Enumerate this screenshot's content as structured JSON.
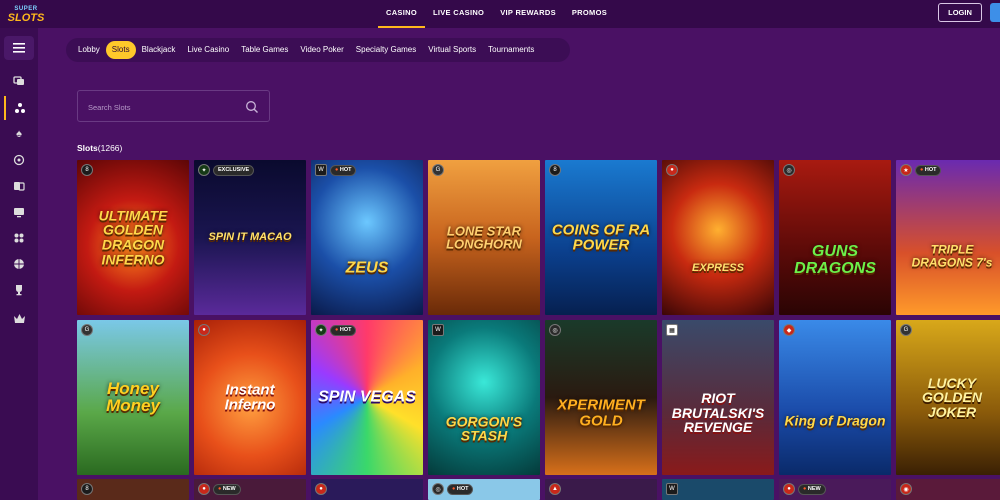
{
  "logo": {
    "line1": "SUPER",
    "line2": "SLOTS"
  },
  "topnav": [
    "CASINO",
    "LIVE CASINO",
    "VIP REWARDS",
    "PROMOS"
  ],
  "topnav_active": "CASINO",
  "login_label": "LOGIN",
  "categories": [
    "Lobby",
    "Slots",
    "Blackjack",
    "Live Casino",
    "Table Games",
    "Video Poker",
    "Specialty Games",
    "Virtual Sports",
    "Tournaments"
  ],
  "active_category": "Slots",
  "search": {
    "placeholder": "Search Slots"
  },
  "section": {
    "title": "Slots",
    "count": "(1266)"
  },
  "sidebar_icons": [
    "menu-icon",
    "chat-icon",
    "slots-icon",
    "spade-icon",
    "roulette-icon",
    "cards-icon",
    "monitor-icon",
    "grid-icon",
    "basketball-icon",
    "trophy-icon",
    "crown-icon"
  ],
  "colors": {
    "accent": "#ffc82a",
    "background": "#4a1164",
    "topbar": "#34094a",
    "sidebar": "#3a0c52"
  },
  "games_row1": [
    {
      "name": "ULTIMATE GOLDEN DRAGON INFERNO",
      "badge": ""
    },
    {
      "name": "SPIN IT MACAO",
      "badge": "EXCLUSIVE"
    },
    {
      "name": "ZEUS",
      "badge": "HOT"
    },
    {
      "name": "LONE STAR LONGHORN",
      "badge": ""
    },
    {
      "name": "COINS OF RA POWER",
      "badge": ""
    },
    {
      "name": "EXPRESS",
      "badge": ""
    },
    {
      "name": "GUNS DRAGONS",
      "badge": ""
    },
    {
      "name": "TRIPLE DRAGONS 7's",
      "badge": "HOT"
    }
  ],
  "games_row2": [
    {
      "name": "Honey Money",
      "badge": ""
    },
    {
      "name": "Instant Inferno",
      "badge": ""
    },
    {
      "name": "SPIN VEGAS",
      "badge": "HOT"
    },
    {
      "name": "GORGON'S STASH",
      "badge": ""
    },
    {
      "name": "XPERIMENT GOLD",
      "badge": ""
    },
    {
      "name": "RIOT BRUTALSKI'S REVENGE",
      "badge": ""
    },
    {
      "name": "King of Dragon",
      "badge": ""
    },
    {
      "name": "LUCKY GOLDEN JOKER",
      "badge": ""
    }
  ],
  "games_row3_badges": [
    "",
    "NEW",
    "",
    "HOT",
    "",
    "",
    "NEW",
    ""
  ]
}
